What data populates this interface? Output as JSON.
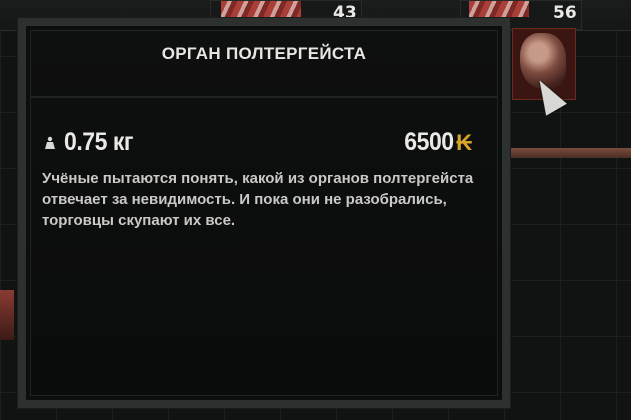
{
  "inventory": {
    "slot_counts": [
      "43",
      "56"
    ]
  },
  "tooltip": {
    "title": "ОРГАН ПОЛТЕРГЕЙСТА",
    "weight": "0.75 кг",
    "weight_icon": "weight-icon",
    "price": "6500",
    "currency_symbol": "₭",
    "currency_color": "#d7a42b",
    "description": "Учёные пытаются понять, какой из органов полтергейста отвечает за невидимость. И пока они не разобрались, торговцы скупают их все."
  }
}
